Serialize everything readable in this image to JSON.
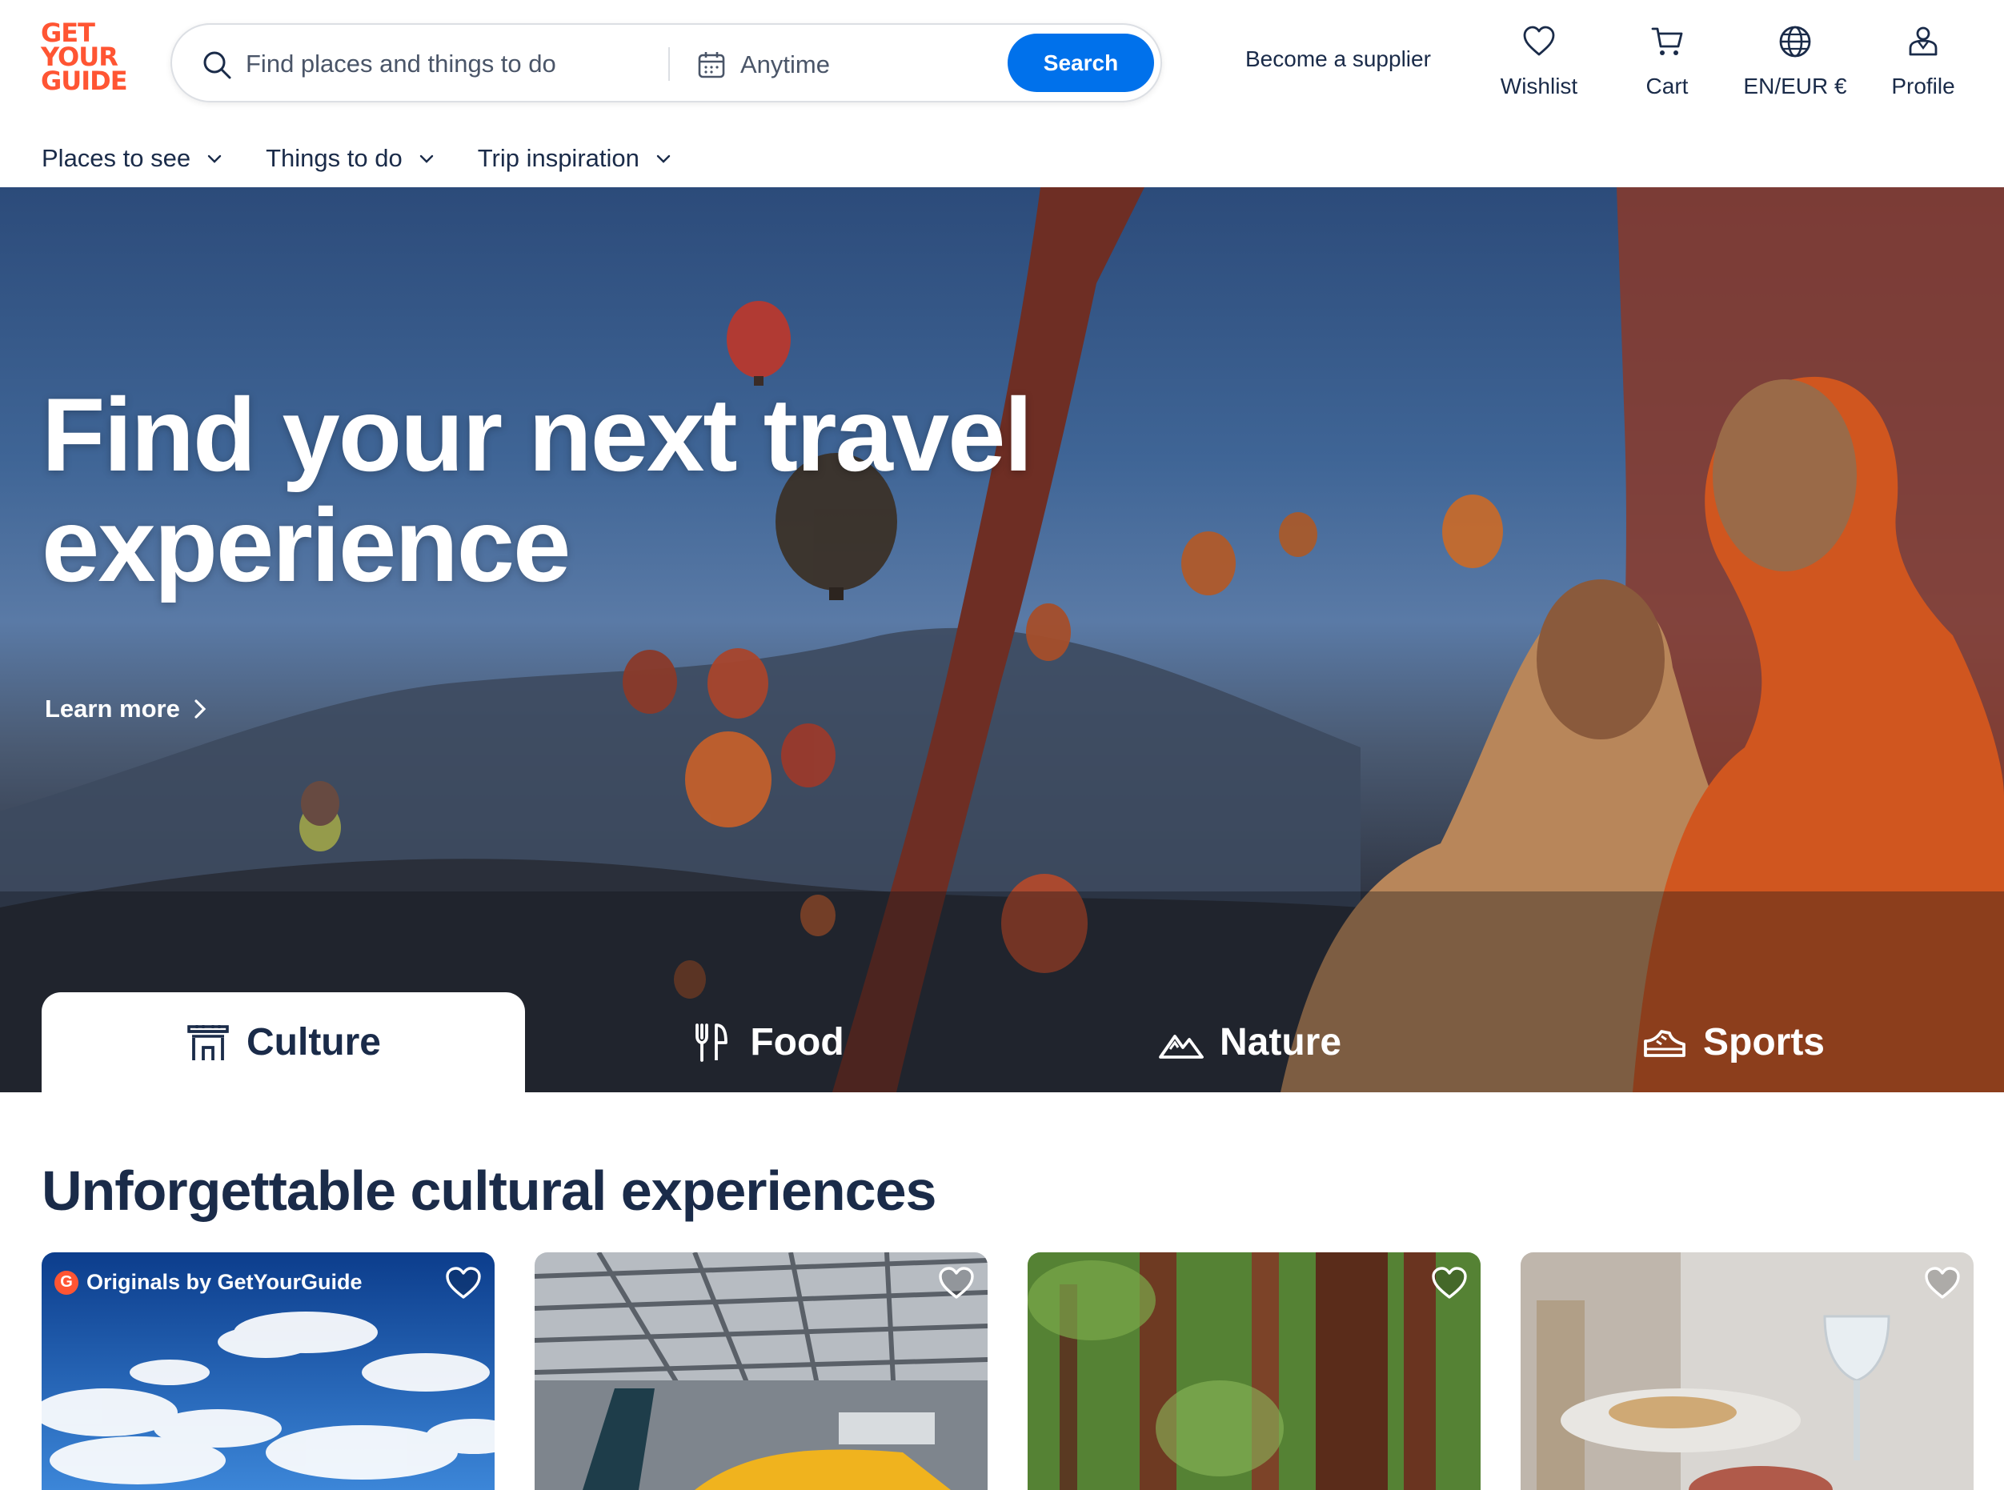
{
  "brand": {
    "logo_lines": [
      "GET",
      "YOUR",
      "GUIDE"
    ],
    "accent": "#ff5533",
    "primary": "#0071eb",
    "text": "#1a2b49"
  },
  "search": {
    "placeholder": "Find places and things to do",
    "date_label": "Anytime",
    "button_label": "Search"
  },
  "header": {
    "supplier_label": "Become a supplier",
    "actions": [
      {
        "label": "Wishlist",
        "icon": "heart-icon"
      },
      {
        "label": "Cart",
        "icon": "cart-icon"
      },
      {
        "label": "EN/EUR €",
        "icon": "globe-icon"
      },
      {
        "label": "Profile",
        "icon": "profile-icon"
      }
    ]
  },
  "subnav": [
    {
      "label": "Places to see"
    },
    {
      "label": "Things to do"
    },
    {
      "label": "Trip inspiration"
    }
  ],
  "hero": {
    "title": "Find your next travel experience",
    "learn_more": "Learn more",
    "tabs": [
      {
        "label": "Culture",
        "icon": "culture-icon",
        "active": true
      },
      {
        "label": "Food",
        "icon": "food-icon",
        "active": false
      },
      {
        "label": "Nature",
        "icon": "nature-icon",
        "active": false
      },
      {
        "label": "Sports",
        "icon": "sports-icon",
        "active": false
      }
    ]
  },
  "section": {
    "title": "Unforgettable cultural experiences"
  },
  "cards": [
    {
      "badge": "Originals by GetYourGuide",
      "badge_icon": "G",
      "image": "sky-clouds"
    },
    {
      "image": "aircraft-carrier-hangar"
    },
    {
      "image": "redwood-forest"
    },
    {
      "image": "restaurant-table"
    }
  ]
}
